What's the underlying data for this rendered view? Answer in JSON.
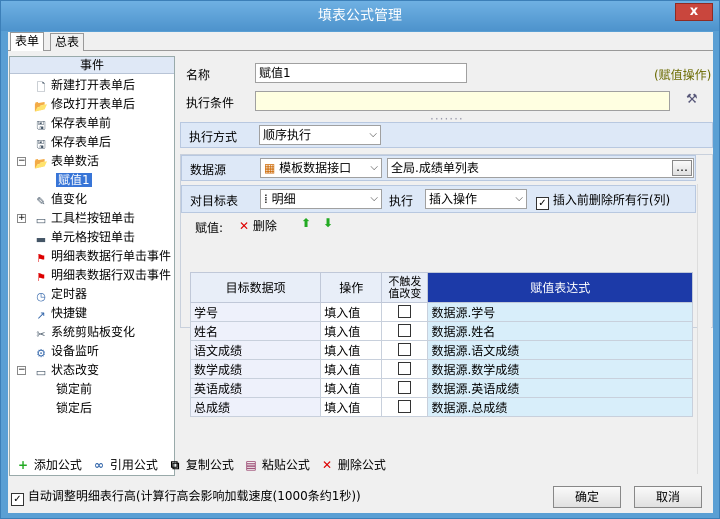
{
  "window": {
    "title": "填表公式管理",
    "close": "x"
  },
  "tabs": [
    "表单",
    "总表"
  ],
  "tree": {
    "header": "事件",
    "items": [
      {
        "label": "新建打开表单后",
        "icon": "new-doc-icon"
      },
      {
        "label": "修改打开表单后",
        "icon": "folder-open-icon"
      },
      {
        "label": "保存表单前",
        "icon": "save-doc-icon"
      },
      {
        "label": "保存表单后",
        "icon": "save-doc-icon"
      },
      {
        "label": "表单数活",
        "icon": "folder-open-icon"
      },
      {
        "label": "赋值1",
        "icon": ""
      },
      {
        "label": "值变化",
        "icon": "edit-icon"
      },
      {
        "label": "工具栏按钮单击",
        "icon": "toolbar-icon"
      },
      {
        "label": "单元格按钮单击",
        "icon": "cell-button-icon"
      },
      {
        "label": "明细表数据行单击事件",
        "icon": "red-flag-icon"
      },
      {
        "label": "明细表数据行双击事件",
        "icon": "red-flag-icon"
      },
      {
        "label": "定时器",
        "icon": "timer-icon"
      },
      {
        "label": "快捷键",
        "icon": "shortcut-icon"
      },
      {
        "label": "系统剪贴板变化",
        "icon": "scissors-icon"
      },
      {
        "label": "设备监听",
        "icon": "device-icon"
      },
      {
        "label": "状态改变",
        "icon": "state-icon"
      },
      {
        "label": "锁定前",
        "icon": ""
      },
      {
        "label": "锁定后",
        "icon": ""
      }
    ]
  },
  "form": {
    "name_label": "名称",
    "name_value": "赋值1",
    "type_hint": "(赋值操作)",
    "cond_label": "执行条件",
    "cond_value": "",
    "exec_mode_label": "执行方式",
    "exec_mode_value": "顺序执行",
    "source_label": "数据源",
    "source_value": "模板数据接口",
    "source_path": "全局.成绩单列表",
    "target_label": "对目标表",
    "target_value": "明细",
    "exec_label": "执行",
    "exec_value": "插入操作",
    "clear_label": "插入前删除所有行(列)",
    "clear_checked": true,
    "assign_label": "赋值:",
    "delete_label": "删除"
  },
  "grid": {
    "headers": [
      "目标数据项",
      "操作",
      "不触发\n值改变",
      "赋值表达式"
    ],
    "rows": [
      {
        "item": "学号",
        "op": "填入值",
        "expr": "数据源.学号"
      },
      {
        "item": "姓名",
        "op": "填入值",
        "expr": "数据源.姓名"
      },
      {
        "item": "语文成绩",
        "op": "填入值",
        "expr": "数据源.语文成绩"
      },
      {
        "item": "数学成绩",
        "op": "填入值",
        "expr": "数据源.数学成绩"
      },
      {
        "item": "英语成绩",
        "op": "填入值",
        "expr": "数据源.英语成绩"
      },
      {
        "item": "总成绩",
        "op": "填入值",
        "expr": "数据源.总成绩"
      }
    ]
  },
  "toolbar": {
    "add": "添加公式",
    "ref": "引用公式",
    "copy": "复制公式",
    "paste": "粘贴公式",
    "del": "删除公式"
  },
  "footer": {
    "auto_height": "自动调整明细表行高(计算行高会影响加载速度(1000条约1秒))",
    "auto_checked": true,
    "ok": "确定",
    "cancel": "取消"
  }
}
